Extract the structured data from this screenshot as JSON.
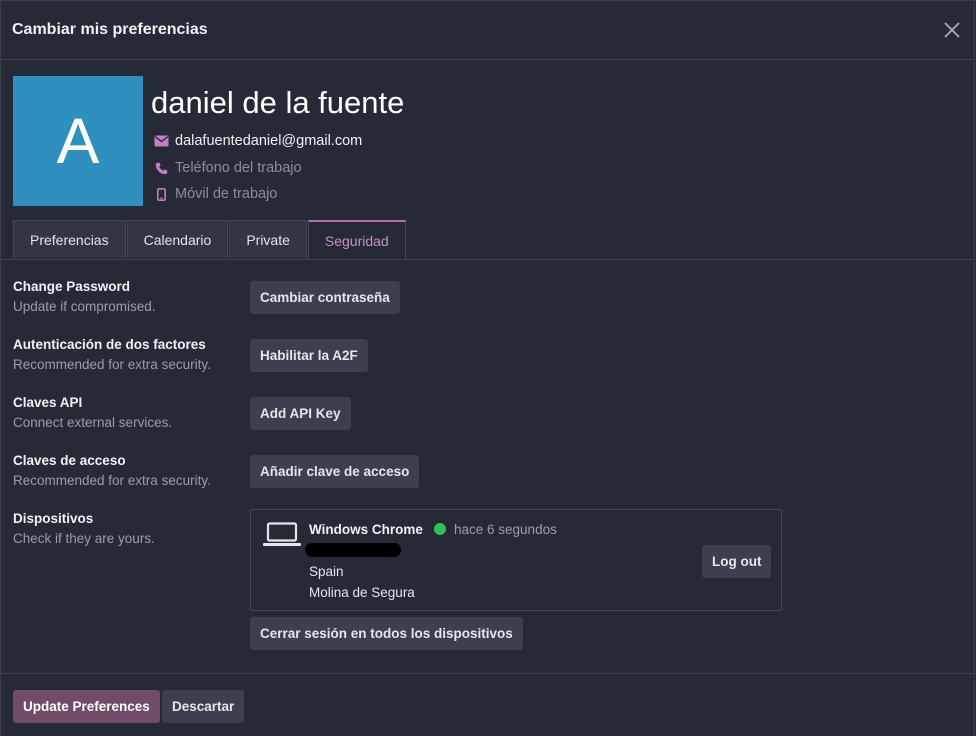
{
  "dialog": {
    "title": "Cambiar mis preferencias"
  },
  "profile": {
    "avatar_letter": "A",
    "avatar_color": "#2f8fbf",
    "name": "daniel de la fuente",
    "email": "dalafuentedaniel@gmail.com",
    "work_phone_placeholder": "Teléfono del trabajo",
    "work_mobile_placeholder": "Móvil de trabajo"
  },
  "tabs": [
    {
      "label": "Preferencias"
    },
    {
      "label": "Calendario"
    },
    {
      "label": "Private"
    },
    {
      "label": "Seguridad",
      "active": true
    }
  ],
  "security": {
    "change_password": {
      "title": "Change Password",
      "subtitle": "Update if compromised.",
      "button": "Cambiar contraseña"
    },
    "two_factor": {
      "title": "Autenticación de dos factores",
      "subtitle": "Recommended for extra security.",
      "button": "Habilitar la A2F"
    },
    "api_keys": {
      "title": "Claves API",
      "subtitle": "Connect external services.",
      "button": "Add API Key"
    },
    "passkeys": {
      "title": "Claves de acceso",
      "subtitle": "Recommended for extra security.",
      "button": "Añadir clave de acceso"
    },
    "devices": {
      "title": "Dispositivos",
      "subtitle": "Check if they are yours.",
      "device": {
        "name": "Windows Chrome",
        "status_color": "#2fbf56",
        "last_active": "hace 6 segundos",
        "country": "Spain",
        "city": "Molina de Segura",
        "logout_button": "Log out"
      },
      "logout_all_button": "Cerrar sesión en todos los dispositivos"
    }
  },
  "footer": {
    "update_button": "Update Preferences",
    "discard_button": "Descartar"
  },
  "colors": {
    "accent": "#714b67",
    "tab_active": "#c890c8",
    "background": "#262a36"
  }
}
